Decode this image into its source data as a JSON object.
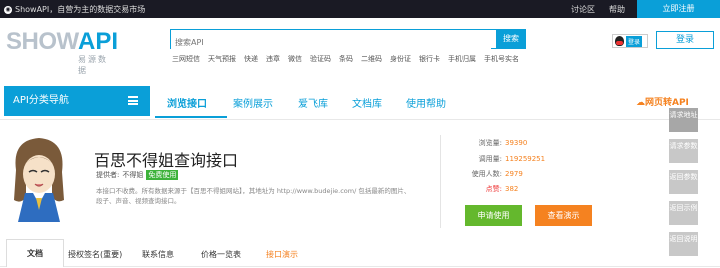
{
  "topbar": {
    "brand": "ShowAPI，自营为主的数据交易市场",
    "links": [
      "讨论区",
      "帮助"
    ],
    "register": "立即注册"
  },
  "logo": {
    "show": "SHOW",
    "api": "API",
    "sub": "易源数据"
  },
  "search": {
    "placeholder": "搜索API",
    "button": "搜索"
  },
  "hotwords": [
    "三网短信",
    "天气预报",
    "快递",
    "违章",
    "微信",
    "验证码",
    "条码",
    "二维码",
    "身份证",
    "银行卡",
    "手机归属",
    "手机号实名"
  ],
  "login": {
    "qq_label": "登录",
    "button": "登录"
  },
  "nav": {
    "category": "API分类导航",
    "tabs": [
      "浏览接口",
      "案例展示",
      "爱飞库",
      "文档库",
      "使用帮助"
    ],
    "web_api": "网页转API"
  },
  "api": {
    "title": "百思不得姐查询接口",
    "provider_label": "提供者:",
    "provider": "不得姐",
    "free_badge": "免费使用",
    "description": "本接口不收费。所有数据来源于【百思不得姐网站】，其地址为 http://www.budejie.com/ 包括最新的图片、段子、声音、视频查询接口。"
  },
  "stats": [
    {
      "label": "浏览量:",
      "value": "39390"
    },
    {
      "label": "调用量:",
      "value": "119259251"
    },
    {
      "label": "使用人数:",
      "value": "2979"
    },
    {
      "label": "点赞:",
      "value": "382"
    }
  ],
  "actions": {
    "apply": "申请使用",
    "demo": "查看演示"
  },
  "side": [
    "请求地址",
    "请求参数",
    "返回参数",
    "返回示例",
    "返回说明"
  ],
  "tabs": [
    "文档",
    "授权签名(重要)",
    "联系信息",
    "价格一览表",
    "接口演示"
  ],
  "colors": {
    "brand_blue": "#0a9fd8",
    "orange": "#f58220",
    "green": "#64b82d"
  }
}
